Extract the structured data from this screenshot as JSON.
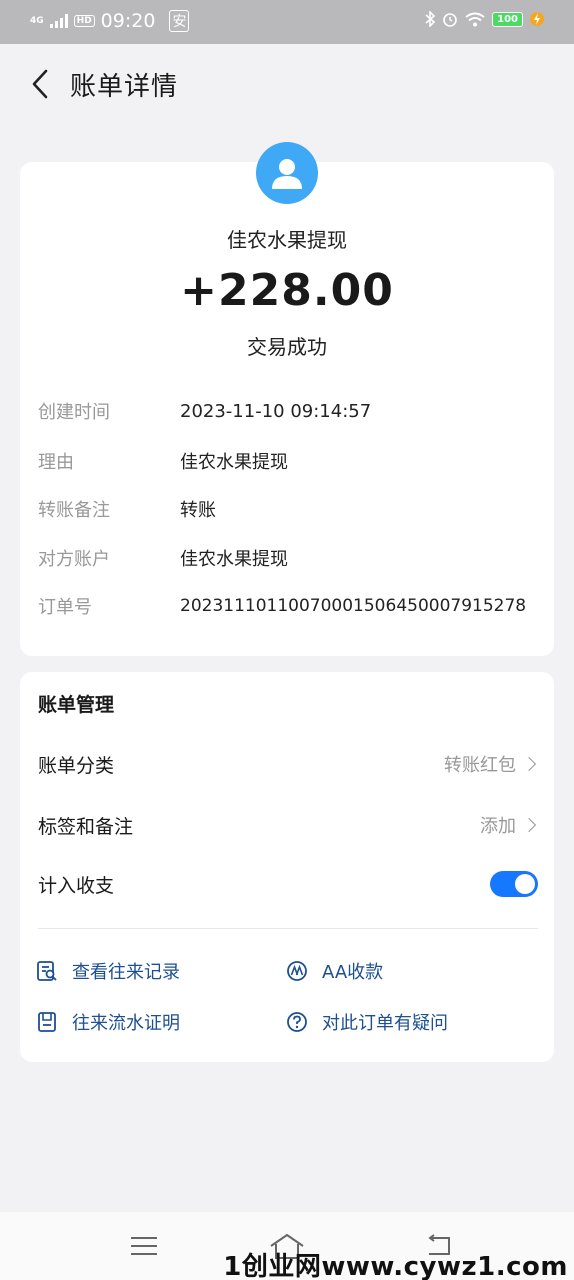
{
  "status_bar": {
    "network": "4G",
    "hd": "HD",
    "time": "09:20",
    "app_badge": "安",
    "battery": "100"
  },
  "header": {
    "title": "账单详情"
  },
  "transaction": {
    "merchant": "佳农水果提现",
    "amount": "+228.00",
    "status": "交易成功",
    "details": [
      {
        "label": "创建时间",
        "value": "2023-11-10 09:14:57"
      },
      {
        "label": "理由",
        "value": "佳农水果提现"
      },
      {
        "label": "转账备注",
        "value": "转账"
      },
      {
        "label": "对方账户",
        "value": "佳农水果提现"
      },
      {
        "label": "订单号",
        "value": "2023111011007000150645000791527­8"
      }
    ]
  },
  "management": {
    "title": "账单管理",
    "category_label": "账单分类",
    "category_value": "转账红包",
    "tags_label": "标签和备注",
    "tags_value": "添加",
    "include_label": "计入收支",
    "include_enabled": true
  },
  "links": {
    "history": "查看往来记录",
    "aa": "AA收款",
    "statement": "往来流水证明",
    "question": "对此订单有疑问"
  },
  "watermark": "1创业网www.cywz1.com",
  "colors": {
    "accent": "#1677ff",
    "link": "#1d4f91",
    "avatar": "#3fa9f5",
    "background": "#f2f2f4"
  }
}
